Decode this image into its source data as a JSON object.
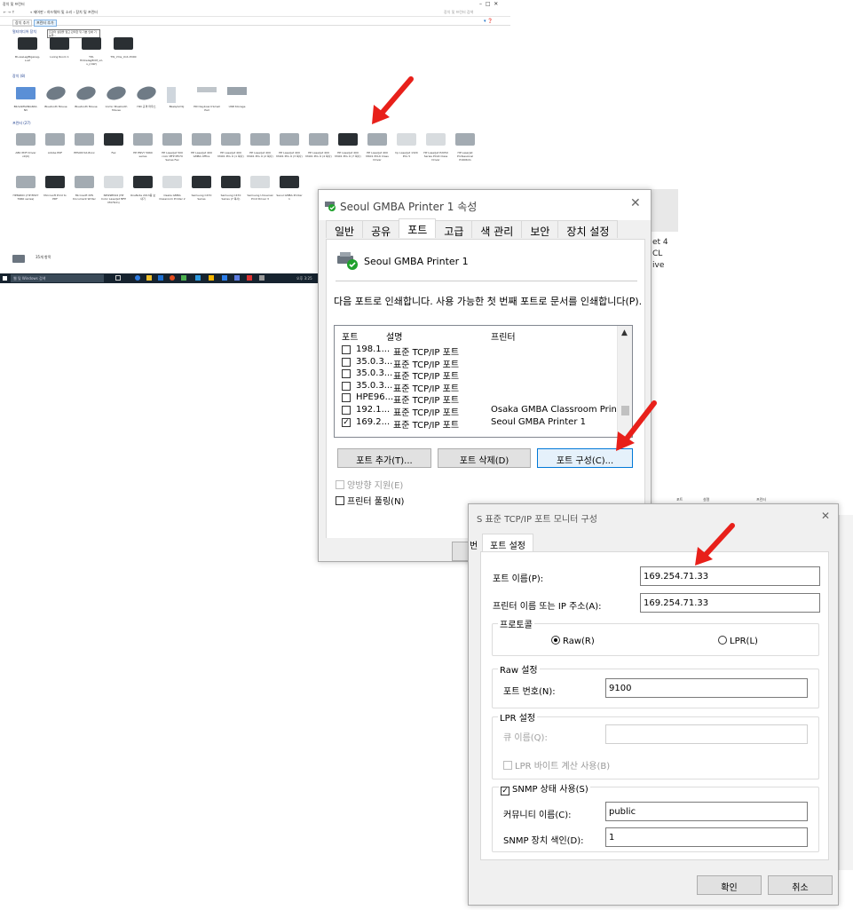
{
  "explorer": {
    "window_title": "장치 및 프린터",
    "breadcrumb": "« 제어판 › 하드웨어 및 소리 › 장치 및 프린터",
    "search_placeholder": "장치 및 프린터 검색",
    "cmd_add_device": "장치 추가",
    "cmd_add_printer": "프린터 추가",
    "section_multimedia": "멀티미디어 장치",
    "section_devices": "장치 (8)",
    "section_printers": "프린터 (27)",
    "tooltip": "프린터 설정을 열고 관리한 뒤 기본 인쇄 기능을...",
    "multimedia": [
      {
        "label": "BI-vesLeg8tgeneg-s-s2"
      },
      {
        "label": "Living Room 1"
      },
      {
        "label": "TW-Hrkkelag8CM_vil-s_(rAW)"
      },
      {
        "label": "TW_Vms_Unt-15l00"
      }
    ],
    "devices": [
      {
        "label": "BK-SAMSUNG662-NV",
        "icon": "laptop-icon"
      },
      {
        "label": "Bluetooth Mouse",
        "icon": "mouse-icon"
      },
      {
        "label": "Bluetooth Mouse",
        "icon": "mouse-icon"
      },
      {
        "label": "Comic Bluetooth Mouse",
        "icon": "mouse-icon"
      },
      {
        "label": "HID 규격 마우스",
        "icon": "mouse-icon"
      },
      {
        "label": "BkeGpVmtj",
        "icon": "tower-icon"
      },
      {
        "label": "HID Keyboard Small Pad",
        "icon": "keyboard-icon"
      },
      {
        "label": "USB Storage",
        "icon": "drive-icon"
      }
    ],
    "printers_row1": [
      "ABC PDF Driver v9(0)",
      "Adobe PDF",
      "EPSON SX-8xxx",
      "Fax",
      "HP ENVY 5660 series",
      "HP LaserJet 500 color MFP M570 Series Fax",
      "HP LaserJet 400 GMBA Office",
      "HP LaserJet 400 M401 PCL 6 (1 복사)",
      "HP LaserJet 400 M401 PCL 6 (2 복사)",
      "HP LaserJet 400 M401 PCL 6 (3 복사)",
      "HP LaserJet 400 M401 PCL 6 (4 복사)",
      "HP LaserJet 400 M401 PCL 6 (7 복사)",
      "HP LaserJet 400 M401 PCL6 Class Driver",
      "hp LaserJet 1320 PCL 5",
      "HP LaserJet P2050 Series PCL6 Class Driver",
      "HP LaserJet Professional P1606dn"
    ],
    "printers_row2": [
      "HP6960C (HP ENVY 5660 series)",
      "Microsoft Print to PDF",
      "Microsoft XPS Document Writer",
      "NPI29B544 (HP Color LaserJet MFP M476dn)",
      "OneNote 2013용 보내기",
      "Osaka GMBA Classroom Printer 2",
      "Samsung C470 Series",
      "Samsung C470 Series (7 복사)",
      "Samsung Universal Print Driver 3",
      "Seoul GMBA Printer 1"
    ],
    "status_count": "35개 항목",
    "taskbar_search": "웹 및 Windows 검색",
    "taskbar_clock": "오후 3:25"
  },
  "props": {
    "title": "Seoul GMBA Printer 1 속성",
    "tabs": [
      "일반",
      "공유",
      "포트",
      "고급",
      "색 관리",
      "보안",
      "장치 설정"
    ],
    "active_tab": "포트",
    "printer_name": "Seoul GMBA Printer 1",
    "instruction": "다음 포트로 인쇄합니다. 사용 가능한 첫 번째 포트로 문서를 인쇄합니다(P).",
    "col_port": "포트",
    "col_desc": "설명",
    "col_printer": "프린터",
    "ports": [
      {
        "port": "198.1...",
        "desc": "표준 TCP/IP 포트",
        "printer": "",
        "checked": false
      },
      {
        "port": "35.0.3...",
        "desc": "표준 TCP/IP 포트",
        "printer": "",
        "checked": false
      },
      {
        "port": "35.0.3...",
        "desc": "표준 TCP/IP 포트",
        "printer": "",
        "checked": false
      },
      {
        "port": "35.0.3...",
        "desc": "표준 TCP/IP 포트",
        "printer": "",
        "checked": false
      },
      {
        "port": "HPE96...",
        "desc": "표준 TCP/IP 포트",
        "printer": "",
        "checked": false
      },
      {
        "port": "192.1...",
        "desc": "표준 TCP/IP 포트",
        "printer": "Osaka GMBA Classroom Print...",
        "checked": false
      },
      {
        "port": "169.2...",
        "desc": "표준 TCP/IP 포트",
        "printer": "Seoul GMBA Printer 1",
        "checked": true
      }
    ],
    "btn_add_port": "포트 추가(T)...",
    "btn_delete_port": "포트 삭제(D)",
    "btn_configure_port": "포트 구성(C)...",
    "bidi_label": "양방향 지원(E)",
    "pooling_label": "프린터 풀링(N)"
  },
  "right_strip": {
    "line1": "et 4",
    "line2": "CL",
    "line3": "ive"
  },
  "tcp": {
    "title": "표준 TCP/IP 포트 모니터 구성",
    "tab": "포트 설정",
    "port_name_label": "포트 이름(P):",
    "port_name_value": "169.254.71.33",
    "host_label": "프린터 이름 또는 IP 주소(A):",
    "host_value": "169.254.71.33",
    "protocol_group": "프로토콜",
    "raw_label": "Raw(R)",
    "lpr_label": "LPR(L)",
    "raw_group": "Raw 설정",
    "port_number_label": "포트 번호(N):",
    "port_number_value": "9100",
    "lpr_group": "LPR 설정",
    "queue_label": "큐 이름(Q):",
    "lpr_byte_label": "LPR 바이트 계산 사용(B)",
    "snmp_label": "SNMP 상태 사용(S)",
    "community_label": "커뮤니티 이름(C):",
    "community_value": "public",
    "snmp_index_label": "SNMP 장치 색인(D):",
    "snmp_index_value": "1",
    "ok_label": "확인",
    "cancel_label": "취소"
  },
  "behind": {
    "dialog_letter": "S",
    "port_tab_letter": "번",
    "ghost_cols": [
      "포트",
      "설명",
      "프린터"
    ]
  },
  "colors": {
    "accent": "#0078d7",
    "arrow": "#e8201a",
    "check_green": "#1fa12c"
  }
}
